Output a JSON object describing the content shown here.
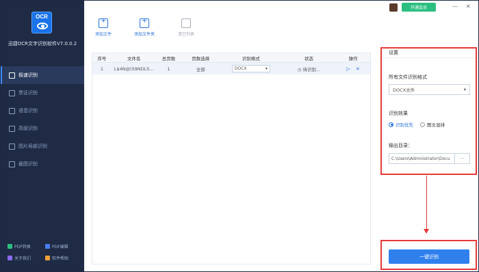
{
  "app": {
    "logo_text": "OCR",
    "title": "迅捷OCR文字识别软件V7.0.0.2"
  },
  "sidebar": {
    "items": [
      {
        "label": "极速识别",
        "icon": "lightning-icon",
        "active": true
      },
      {
        "label": "票证识别",
        "icon": "ticket-icon",
        "active": false
      },
      {
        "label": "语音识别",
        "icon": "microphone-icon",
        "active": false
      },
      {
        "label": "高级识别",
        "icon": "advanced-icon",
        "active": false
      },
      {
        "label": "图片局部识别",
        "icon": "crop-icon",
        "active": false
      },
      {
        "label": "截图识别",
        "icon": "screenshot-icon",
        "active": false
      }
    ],
    "bottom_links": [
      {
        "label": "PDF转换",
        "color": "#2dbf82"
      },
      {
        "label": "PDF编辑",
        "color": "#4a7ef0"
      },
      {
        "label": "关于我们",
        "color": "#8a6cf0"
      },
      {
        "label": "软件帮助",
        "color": "#f0a03c"
      }
    ]
  },
  "topbar": {
    "vip_label": "开通会员",
    "minimize": "—",
    "close": "✕"
  },
  "toolbar": {
    "add_file": "添加文件",
    "add_folder": "添加文件夹",
    "clear_list": "清空列表"
  },
  "table": {
    "headers": [
      "序号",
      "文件名",
      "总页数",
      "页数选择",
      "识别格式",
      "状态",
      "操作"
    ],
    "rows": [
      {
        "index": "1",
        "filename": "L$4N@(S9NDLS...",
        "pages": "1",
        "page_select": "全部",
        "format": "DOCX",
        "status": "待识别..."
      }
    ]
  },
  "settings": {
    "title": "设置",
    "format_label": "所有文件识别格式",
    "format_value": "DOCX文件",
    "effect_label": "识别效果",
    "effect_options": [
      "识别优先",
      "图文混排"
    ],
    "output_label": "输出目录：",
    "output_path": "C:\\Users\\Administrator\\Docu",
    "browse": "···"
  },
  "action": {
    "recognize_label": "一键识别"
  },
  "colors": {
    "accent": "#2f80ed",
    "sidebar_bg": "#1f2b45",
    "highlight_border": "#e53935",
    "vip_green": "#2dbf82"
  }
}
